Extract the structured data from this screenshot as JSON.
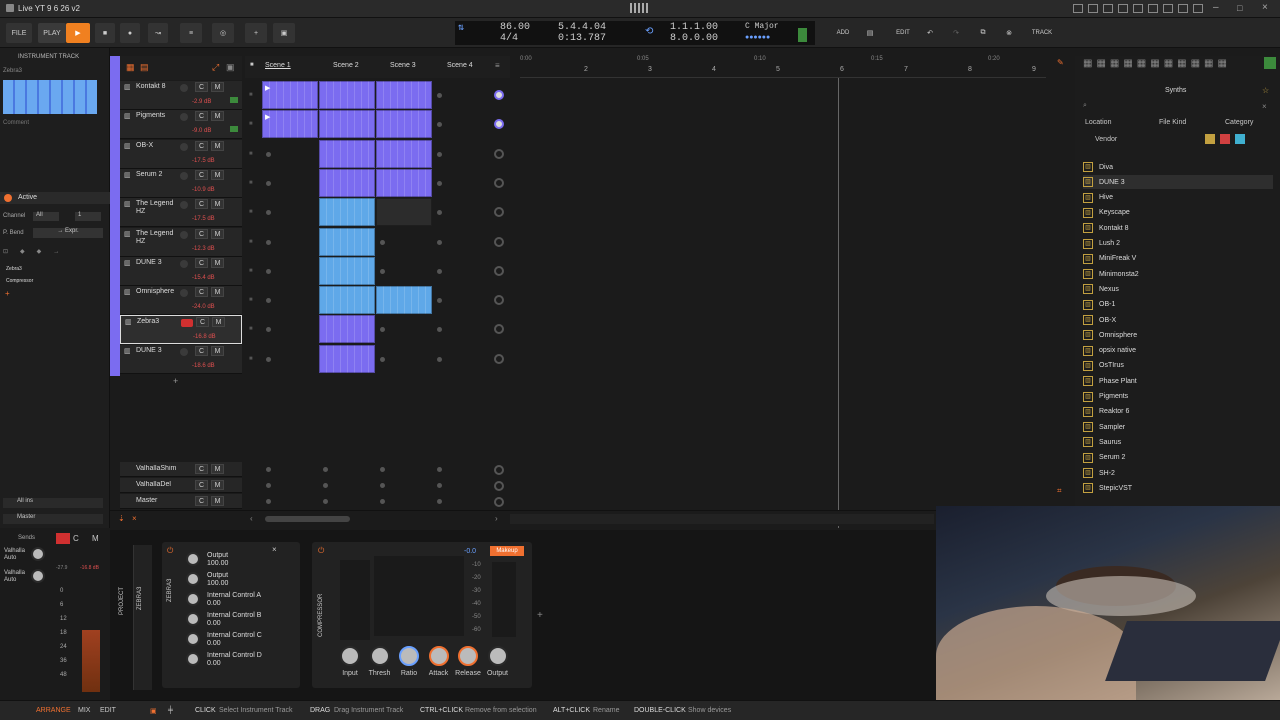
{
  "window": {
    "title": "Live YT 9 6 26 v2"
  },
  "transport": {
    "file": "FILE",
    "play": "PLAY",
    "tempo": "86.00",
    "signature": "4/4",
    "position_bars": "5.4.4.04",
    "position_time": "0:13.787",
    "loop_start": "1.1.1.00",
    "loop_length": "8.0.0.00",
    "key": "C Major",
    "add": "ADD",
    "edit": "EDIT",
    "track": "TRACK"
  },
  "inspector": {
    "header": "INSTRUMENT TRACK",
    "track_name": "Zebra3",
    "comment_placeholder": "Comment",
    "active": "Active",
    "channel_label": "Channel",
    "channel_value": "All",
    "channel_num": "1",
    "pbend_label": "P. Bend",
    "pbend_value": "→ Expr.",
    "chain": [
      "Zebra3",
      "Compressor"
    ],
    "inputs": "All ins",
    "output": "Master"
  },
  "tracks": [
    {
      "name": "Kontakt 8",
      "db": "-2.9 dB",
      "color": "#7b6cf0"
    },
    {
      "name": "Pigments",
      "db": "-9.0 dB",
      "color": "#7b6cf0"
    },
    {
      "name": "OB-X",
      "db": "-17.5 dB",
      "color": "#7b6cf0"
    },
    {
      "name": "Serum 2",
      "db": "-10.9 dB",
      "color": "#7b6cf0"
    },
    {
      "name": "The Legend HZ",
      "db": "-17.5 dB",
      "color": "#5fa8e8"
    },
    {
      "name": "The Legend HZ",
      "db": "-12.3 dB",
      "color": "#5fa8e8"
    },
    {
      "name": "DUNE 3",
      "db": "-15.4 dB",
      "color": "#5fa8e8"
    },
    {
      "name": "Omnisphere",
      "db": "-24.0 dB",
      "color": "#5fa8e8"
    },
    {
      "name": "Zebra3",
      "db": "-16.8 dB",
      "color": "#7b6cf0"
    },
    {
      "name": "DUNE 3",
      "db": "-18.6 dB",
      "color": "#7b6cf0"
    }
  ],
  "fx_tracks": [
    {
      "name": "ValhallaShim"
    },
    {
      "name": "ValhallaDel"
    },
    {
      "name": "Master"
    }
  ],
  "scenes": [
    "Scene 1",
    "Scene 2",
    "Scene 3",
    "Scene 4"
  ],
  "ruler": [
    "2",
    "3",
    "4",
    "5",
    "6",
    "7",
    "8",
    "9"
  ],
  "ruler_times": [
    "0:00",
    "0:05",
    "0:10",
    "0:15",
    "0:20"
  ],
  "browser": {
    "title": "Synths",
    "filters": [
      "Location",
      "File Kind",
      "Category",
      "Vendor"
    ],
    "items": [
      "Diva",
      "DUNE 3",
      "Hive",
      "Keyscape",
      "Kontakt 8",
      "Lush 2",
      "MiniFreak V",
      "Minimonsta2",
      "Nexus",
      "OB-1",
      "OB-X",
      "Omnisphere",
      "opsix native",
      "OsTIrus",
      "Phase Plant",
      "Pigments",
      "Reaktor 6",
      "Sampler",
      "Saurus",
      "Serum 2",
      "SH-2",
      "StepicVST"
    ]
  },
  "device": {
    "sends_label": "Sends",
    "sends": [
      "Valhalla Auto",
      "Valhalla Auto"
    ],
    "meter_db": [
      "-27.9",
      "-16.8 dB"
    ],
    "meter_ticks": [
      "0",
      "6",
      "12",
      "18",
      "24",
      "36",
      "48"
    ],
    "project_tab": "PROJECT",
    "zebra_tab": "ZEBRA3",
    "zebra_title": "ZEBRA3",
    "comp_title": "COMPRESSOR",
    "params": [
      {
        "name": "Output",
        "value": "100.00"
      },
      {
        "name": "Output",
        "value": "100.00"
      },
      {
        "name": "Internal Control A",
        "value": "0.00"
      },
      {
        "name": "Internal Control B",
        "value": "0.00"
      },
      {
        "name": "Internal Control C",
        "value": "0.00"
      },
      {
        "name": "Internal Control D",
        "value": "0.00"
      }
    ],
    "comp_gain": "-0.0",
    "makeup": "Makeup",
    "comp_scale": [
      "-10",
      "-20",
      "-30",
      "-40",
      "-50",
      "-60"
    ],
    "comp_knobs": [
      "Input",
      "Thresh",
      "Ratio",
      "Attack",
      "Release",
      "Output"
    ]
  },
  "status": {
    "tabs": [
      "ARRANGE",
      "MIX",
      "EDIT"
    ],
    "hints": [
      {
        "key": "CLICK",
        "text": "Select Instrument Track"
      },
      {
        "key": "DRAG",
        "text": "Drag Instrument Track"
      },
      {
        "key": "CTRL+CLICK",
        "text": "Remove from selection"
      },
      {
        "key": "ALT+CLICK",
        "text": "Rename"
      },
      {
        "key": "DOUBLE-CLICK",
        "text": "Show devices"
      }
    ]
  }
}
